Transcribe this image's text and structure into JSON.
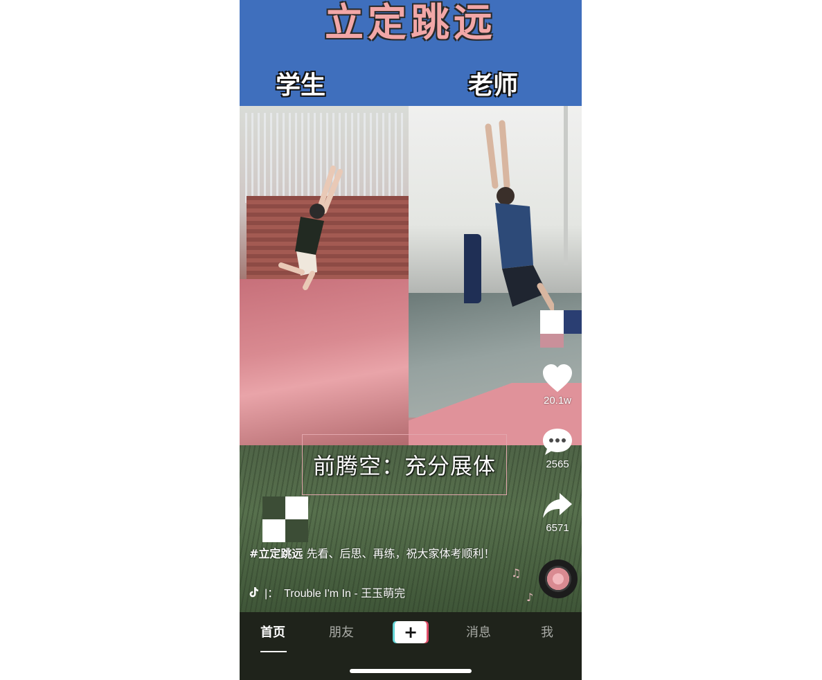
{
  "video": {
    "banner_title": "立定跳远",
    "left_label": "学生",
    "right_label": "老师",
    "caption": "前腾空：充分展体"
  },
  "actions": {
    "likes": "20.1w",
    "comments": "2565",
    "shares": "6571"
  },
  "description": {
    "hashtag": "#立定跳远",
    "text": " 先看、后思、再练，祝大家体考顺利！"
  },
  "music": {
    "separator": "|：",
    "track": "Trouble I'm In - 王玉萌完"
  },
  "nav": {
    "home": "首页",
    "friends": "朋友",
    "create": "+",
    "messages": "消息",
    "me": "我"
  },
  "colors": {
    "banner": "#3f6fbd",
    "nav_bg": "#1f231b",
    "accent_cyan": "#63d4d6",
    "accent_red": "#e04e69"
  }
}
